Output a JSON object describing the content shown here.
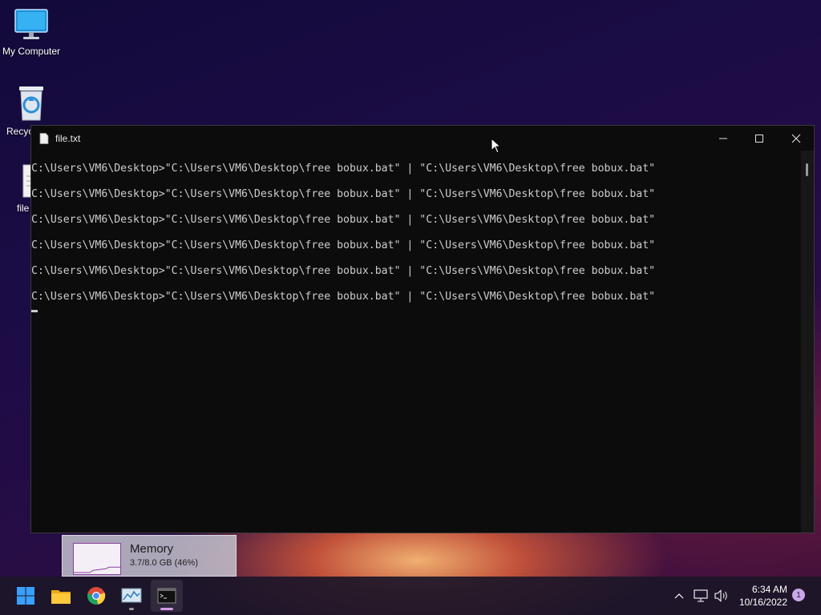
{
  "desktop": {
    "icons": [
      {
        "label": "My Computer"
      },
      {
        "label": "Recyc"
      },
      {
        "label": "file"
      }
    ]
  },
  "window": {
    "title": "file.txt",
    "buttons": [
      "minimize",
      "maximize",
      "close"
    ],
    "lines": [
      "C:\\Users\\VM6\\Desktop>\"C:\\Users\\VM6\\Desktop\\free bobux.bat\" | \"C:\\Users\\VM6\\Desktop\\free bobux.bat\"",
      "C:\\Users\\VM6\\Desktop>\"C:\\Users\\VM6\\Desktop\\free bobux.bat\" | \"C:\\Users\\VM6\\Desktop\\free bobux.bat\"",
      "C:\\Users\\VM6\\Desktop>\"C:\\Users\\VM6\\Desktop\\free bobux.bat\" | \"C:\\Users\\VM6\\Desktop\\free bobux.bat\"",
      "C:\\Users\\VM6\\Desktop>\"C:\\Users\\VM6\\Desktop\\free bobux.bat\" | \"C:\\Users\\VM6\\Desktop\\free bobux.bat\"",
      "C:\\Users\\VM6\\Desktop>\"C:\\Users\\VM6\\Desktop\\free bobux.bat\" | \"C:\\Users\\VM6\\Desktop\\free bobux.bat\"",
      "C:\\Users\\VM6\\Desktop>\"C:\\Users\\VM6\\Desktop\\free bobux.bat\" | \"C:\\Users\\VM6\\Desktop\\free bobux.bat\""
    ]
  },
  "memory_widget": {
    "title": "Memory",
    "usage": "3.7/8.0 GB (46%)",
    "usage_fraction": 0.46
  },
  "taskbar": {
    "apps": [
      "start-icon",
      "file-explorer-icon",
      "chrome-icon",
      "task-manager-icon",
      "terminal-icon"
    ],
    "time": "6:34 AM",
    "date": "10/16/2022",
    "notification_count": "1"
  },
  "colors": {
    "console_bg": "#0c0c0c",
    "console_text": "#cccccc",
    "accent": "#c9a7e8"
  }
}
